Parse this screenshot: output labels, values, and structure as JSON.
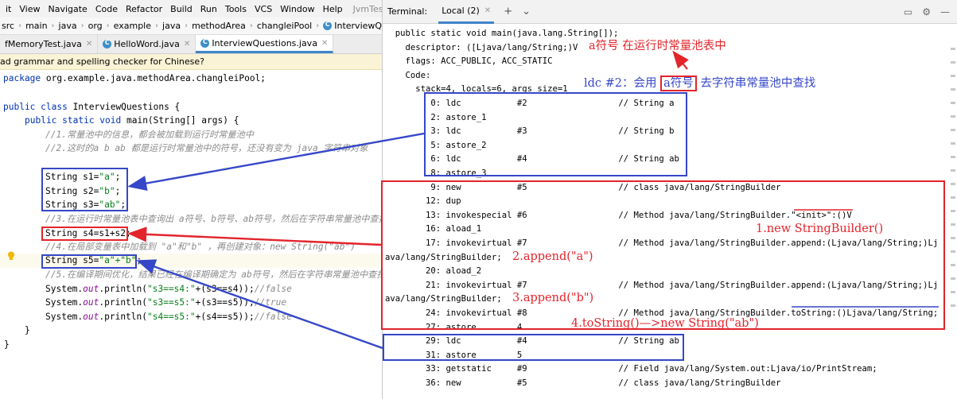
{
  "menubar": {
    "items": [
      "it",
      "View",
      "Navigate",
      "Code",
      "Refactor",
      "Build",
      "Run",
      "Tools",
      "VCS",
      "Window",
      "Help"
    ],
    "window_title": "JvmTest - Intervie"
  },
  "breadcrumb": [
    "src",
    "main",
    "java",
    "org",
    "example",
    "java",
    "methodArea",
    "changleiPool",
    "InterviewQuestions",
    "m"
  ],
  "tabs": [
    {
      "label": "fMemoryTest.java",
      "active": false
    },
    {
      "label": "HelloWord.java",
      "active": false
    },
    {
      "label": "InterviewQuestions.java",
      "active": true
    }
  ],
  "notice": "ad grammar and spelling checker for Chinese?",
  "code": {
    "l_package_kw": "package",
    "l_package_rest": " org.example.java.methodArea.changleiPool;",
    "l_class_kw": "public class",
    "l_class_rest": " InterviewQuestions {",
    "l_main_kw": "public static void",
    "l_main_rest": " main(String[] args) {",
    "l_c1": "//1.常量池中的信息，都会被加载到运行时常量池中",
    "l_c2": "//2.这时的a b ab 都是运行时常量池中的符号，还没有变为 java 字符串对象",
    "l_s1_a": "String s1=",
    "l_s1_b": "\"a\"",
    "l_s1_c": ";",
    "l_s2_a": "String s2=",
    "l_s2_b": "\"b\"",
    "l_s2_c": ";",
    "l_s3_a": "String s3=",
    "l_s3_b": "\"ab\"",
    "l_s3_c": ";",
    "l_c3": "//3.在运行时常量池表中查询出 a符号、b符号、ab符号，然后在字符串常量池中查找对象",
    "l_s4": "String s4=s1+s2;",
    "l_c4": "//4.在局部变量表中加载到 \"a\"和\"b\" ，再创建对象：new String(\"ab\")",
    "l_s5_a": "String s5=",
    "l_s5_b": "\"a\"+\"b\"",
    "l_s5_c": ";",
    "l_c5": "//5.在编译期间优化，结果已经在编译期确定为 ab符号，然后在字符串常量池中查找对象",
    "l_p1_a": "System.",
    "l_p1_b": "out",
    "l_p1_c": ".println(",
    "l_p1_d": "\"s3==s4:\"",
    "l_p1_e": "+(s3==s4));",
    "l_p1_f": "//false",
    "l_p2_a": "System.",
    "l_p2_b": "out",
    "l_p2_c": ".println(",
    "l_p2_d": "\"s3==s5:\"",
    "l_p2_e": "+(s3==s5));",
    "l_p2_f": "//true",
    "l_p3_a": "System.",
    "l_p3_b": "out",
    "l_p3_c": ".println(",
    "l_p3_d": "\"s4==s5:\"",
    "l_p3_e": "+(s4==s5));",
    "l_p3_f": "//false",
    "l_close1": "}",
    "l_close2": "}"
  },
  "terminal": {
    "title": "Terminal:",
    "tab": "Local (2)",
    "lines": [
      "  public static void main(java.lang.String[]);",
      "    descriptor: ([Ljava/lang/String;)V",
      "    flags: ACC_PUBLIC, ACC_STATIC",
      "    Code:",
      "      stack=4, locals=6, args_size=1",
      "         0: ldc           #2                  // String a",
      "         2: astore_1",
      "         3: ldc           #3                  // String b",
      "         5: astore_2",
      "         6: ldc           #4                  // String ab",
      "         8: astore_3",
      "         9: new           #5                  // class java/lang/StringBuilder",
      "        12: dup",
      "        13: invokespecial #6                  // Method java/lang/StringBuilder.\"<init>\":()V",
      "        16: aload_1",
      "        17: invokevirtual #7                  // Method java/lang/StringBuilder.append:(Ljava/lang/String;)Lj",
      "ava/lang/StringBuilder;",
      "        20: aload_2",
      "        21: invokevirtual #7                  // Method java/lang/StringBuilder.append:(Ljava/lang/String;)Lj",
      "ava/lang/StringBuilder;",
      "        24: invokevirtual #8                  // Method java/lang/StringBuilder.toString:()Ljava/lang/String;",
      "        27: astore        4",
      "        29: ldc           #4                  // String ab",
      "        31: astore        5",
      "        33: getstatic     #9                  // Field java/lang/System.out:Ljava/io/PrintStream;",
      "        36: new           #5                  // class java/lang/StringBuilder"
    ]
  },
  "annotations": {
    "runtime_pool_note": "a符号 在运行时常量池表中",
    "ldc_note_prefix": "ldc #2：会用 ",
    "ldc_note_boxed": "a符号",
    "ldc_note_suffix": " 去字符串常量池中查找",
    "step1": "1.new StringBuilder()",
    "step2": "2.append(\"a\")",
    "step3": "3.append(\"b\")",
    "step4": "4.toString()—>new String(\"ab\")"
  },
  "colors": {
    "keyword": "#0033b3",
    "comment": "#8c8c8c",
    "string": "#067d17",
    "field": "#871094",
    "annotation_red": "#e3242b",
    "annotation_blue": "#3547c8"
  }
}
